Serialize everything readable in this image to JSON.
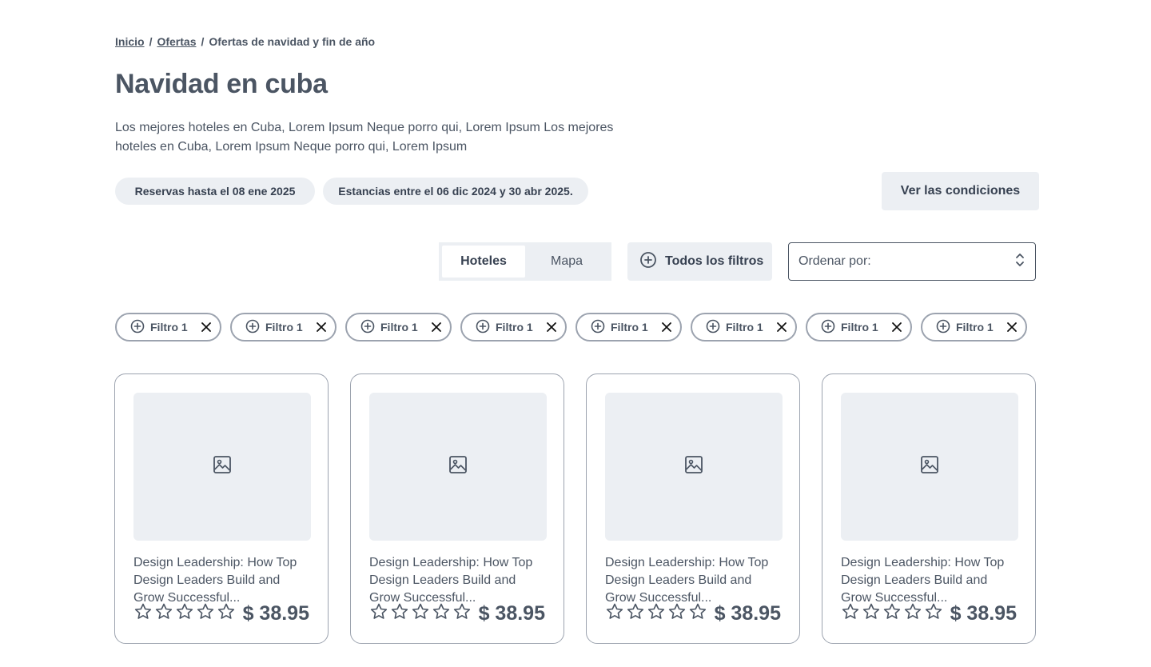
{
  "breadcrumb": {
    "home": "Inicio",
    "offers": "Ofertas",
    "current": "Ofertas de navidad y fin de año",
    "separator": "/"
  },
  "header": {
    "title": "Navidad en cuba",
    "description": "Los mejores hoteles en Cuba, Lorem Ipsum Neque porro qui, Lorem Ipsum Los mejores hoteles en Cuba, Lorem Ipsum Neque porro qui, Lorem Ipsum"
  },
  "badges": {
    "booking": "Reservas hasta el 08 ene 2025",
    "stays": "Estancias entre el 06 dic 2024 y 30 abr 2025."
  },
  "conditions_button": "Ver las condiciones",
  "view_toggle": {
    "hotels": "Hoteles",
    "map": "Mapa",
    "active": "Hoteles"
  },
  "all_filters_button": "Todos los filtros",
  "sort": {
    "label": "Ordenar por:"
  },
  "filter_chips": [
    "Filtro 1",
    "Filtro 1",
    "Filtro 1",
    "Filtro 1",
    "Filtro 1",
    "Filtro 1",
    "Filtro 1",
    "Filtro 1"
  ],
  "cards": [
    {
      "title": "Design Leadership: How Top Design Leaders Build and Grow Successful...",
      "price": "$ 38.95",
      "rating": 0,
      "max_rating": 5
    },
    {
      "title": "Design Leadership: How Top Design Leaders Build and Grow Successful...",
      "price": "$ 38.95",
      "rating": 0,
      "max_rating": 5
    },
    {
      "title": "Design Leadership: How Top Design Leaders Build and Grow Successful...",
      "price": "$ 38.95",
      "rating": 0,
      "max_rating": 5
    },
    {
      "title": "Design Leadership: How Top Design Leaders Build and Grow Successful...",
      "price": "$ 38.95",
      "rating": 0,
      "max_rating": 5
    }
  ],
  "colors": {
    "text": "#4b5563",
    "surface": "#eceff3",
    "border": "#9ca3af"
  }
}
